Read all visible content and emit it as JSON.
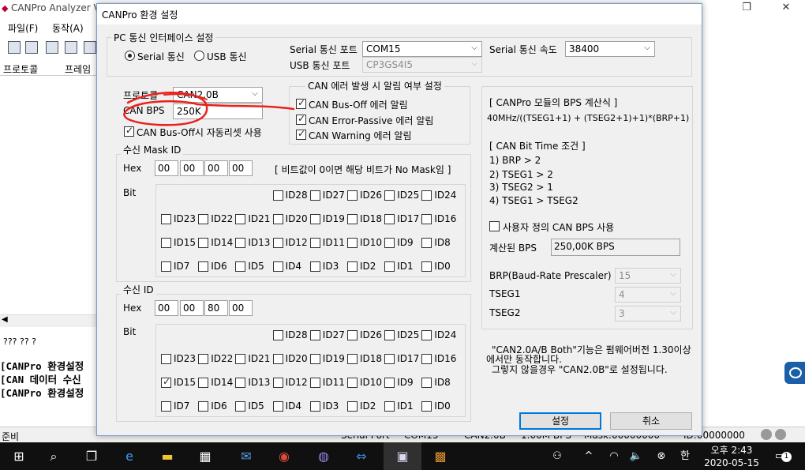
{
  "background_app": {
    "title": "CANPro Analyzer V",
    "menu": [
      "파일(F)",
      "동작(A)"
    ],
    "columns": [
      "프로토콜",
      "프레임"
    ],
    "question_text": "??? ?? ?",
    "log_lines": [
      "[CANPro 환경설정",
      "[CAN 데이터 수신",
      "[CANPro 환경설정"
    ],
    "status": {
      "ready": "준비",
      "serial_port": "Serial Port",
      "com": "COM15",
      "protocol": "CAN2.0B",
      "bps": "1.00M BPS",
      "mask": "Mask:00000000",
      "id": "ID:00000000"
    }
  },
  "dialog": {
    "title": "CANPro 환경 설정",
    "pc_interface": {
      "group_label": "PC 통신 인터페이스 설정",
      "serial_radio": "Serial 통신",
      "usb_radio": "USB 통신",
      "serial_port_label": "Serial 통신 포트",
      "serial_port_value": "COM15",
      "usb_port_label": "USB 통신 포트",
      "usb_port_value": "CP3GS4I5",
      "serial_speed_label": "Serial 통신 속도",
      "serial_speed_value": "38400"
    },
    "protocol_label": "프로토콜",
    "protocol_value": "CAN2.0B",
    "can_bps_label": "CAN BPS",
    "can_bps_value": "250K",
    "auto_reset_label": "CAN Bus-Off시 자동리셋 사용",
    "alerts": {
      "group_label": "CAN 에러 발생 시 알림 여부 설정",
      "items": [
        "CAN Bus-Off 에러 알림",
        "CAN Error-Passive 에러 알림",
        "CAN Warning 에러 알림"
      ]
    },
    "mask": {
      "group_label": "수신 Mask ID",
      "hex_label": "Hex",
      "hex_values": [
        "00",
        "00",
        "00",
        "00"
      ],
      "note": "[ 비트값이 0이면 해당 비트가 No Mask임 ]",
      "bit_label": "Bit"
    },
    "recv_id": {
      "group_label": "수신 ID",
      "hex_label": "Hex",
      "hex_values": [
        "00",
        "00",
        "80",
        "00"
      ],
      "bit_label": "Bit"
    },
    "bit_rows": [
      [
        "ID28",
        "ID27",
        "ID26",
        "ID25",
        "ID24"
      ],
      [
        "ID23",
        "ID22",
        "ID21",
        "ID20",
        "ID19",
        "ID18",
        "ID17",
        "ID16"
      ],
      [
        "ID15",
        "ID14",
        "ID13",
        "ID12",
        "ID11",
        "ID10",
        "ID9",
        "ID8"
      ],
      [
        "ID7",
        "ID6",
        "ID5",
        "ID4",
        "ID3",
        "ID2",
        "ID1",
        "ID0"
      ]
    ],
    "checked_bits": {
      "mask": [],
      "recv_id": [
        "ID15"
      ]
    },
    "bps_info": {
      "formula_title": "[ CANPro 모듈의 BPS 계산식 ]",
      "formula": "40MHz/((TSEG1+1) + (TSEG2+1)+1)*(BRP+1)",
      "conditions_title": "[ CAN Bit Time 조건 ]",
      "conditions": [
        "1) BRP > 2",
        "2) TSEG1 > 2",
        "3) TSEG2 > 1",
        "4) TSEG1 > TSEG2"
      ],
      "custom_bps_label": "사용자 정의 CAN BPS 사용",
      "computed_label": "계산된 BPS",
      "computed_value": "250,00K BPS",
      "brp_label": "BRP(Baud-Rate Prescaler)",
      "brp_value": "15",
      "tseg1_label": "TSEG1",
      "tseg1_value": "4",
      "tseg2_label": "TSEG2",
      "tseg2_value": "3"
    },
    "notice_line1": "\"CAN2.0A/B Both\"기능은 펌웨어버전 1.30이상",
    "notice_line2": "에서만 동작합니다.",
    "notice_line3": "그렇지 않을경우 \"CAN2.0B\"로 설정됩니다.",
    "ok_button": "설정",
    "cancel_button": "취소"
  },
  "taskbar": {
    "ime": "한",
    "time": "오후 2:43",
    "date": "2020-05-15",
    "notification_count": "1"
  },
  "colors": {
    "annotation": "#e8231e",
    "dialog_bg": "#f0f0f0",
    "taskbar": "#101010",
    "accent": "#0078d7"
  }
}
